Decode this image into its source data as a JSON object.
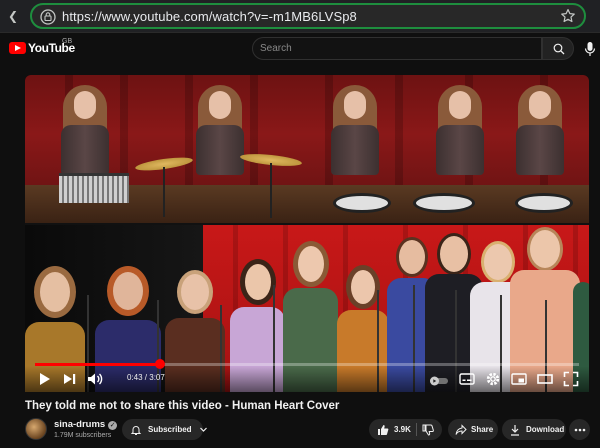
{
  "browser": {
    "url": "https://www.youtube.com/watch?v=-m1MB6LVSp8"
  },
  "header": {
    "logo_text": "YouTube",
    "region": "GB",
    "search_placeholder": "Search"
  },
  "player": {
    "current_time": "0:43",
    "duration": "3:07",
    "time_display": "0:43 / 3:07",
    "progress": 0.23
  },
  "video": {
    "title": "They told me not to share this video - Human Heart Cover",
    "channel_name": "sina-drums",
    "subscribers": "1.79M subscribers",
    "subscribed_label": "Subscribed",
    "likes": "3.9K",
    "share_label": "Share",
    "download_label": "Download"
  },
  "colors": {
    "accent": "#ff0000",
    "background": "#0f0f0f",
    "url_border": "#1e8e3e"
  },
  "icons": {
    "tune": "tune-icon",
    "star": "star-icon",
    "search": "search-icon",
    "mic": "mic-icon",
    "play": "play-icon",
    "next": "next-icon",
    "volume": "volume-icon",
    "autoplay": "autoplay-toggle-icon",
    "subtitles": "subtitles-icon",
    "settings": "settings-icon",
    "miniplayer": "miniplayer-icon",
    "theater": "theater-icon",
    "fullscreen": "fullscreen-icon",
    "bell": "bell-icon",
    "like": "thumbs-up-icon",
    "dislike": "thumbs-down-icon",
    "share": "share-icon",
    "download": "download-icon",
    "more": "more-icon"
  }
}
